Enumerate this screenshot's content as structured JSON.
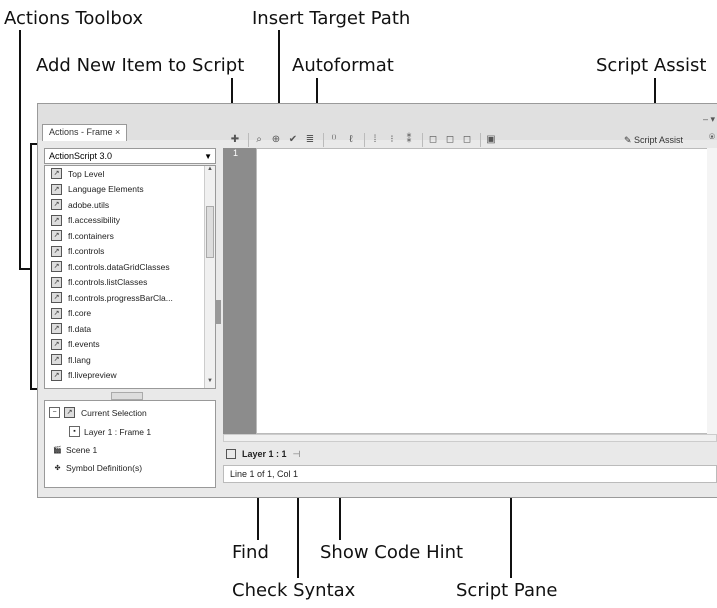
{
  "callouts": {
    "actions_toolbox": "Actions Toolbox",
    "insert_target_path": "Insert Target Path",
    "add_new_item": "Add New Item to Script",
    "autoformat": "Autoformat",
    "script_assist": "Script Assist",
    "find": "Find",
    "show_code_hint": "Show Code Hint",
    "check_syntax": "Check Syntax",
    "script_pane": "Script Pane"
  },
  "panel": {
    "tab_label": "Actions - Frame ×",
    "actionscript_version": "ActionScript 3.0",
    "toolbox_items": [
      "Top Level",
      "Language Elements",
      "adobe.utils",
      "fl.accessibility",
      "fl.containers",
      "fl.controls",
      "fl.controls.dataGridClasses",
      "fl.controls.listClasses",
      "fl.controls.progressBarCla...",
      "fl.core",
      "fl.data",
      "fl.events",
      "fl.lang",
      "fl.livepreview"
    ],
    "lower_items": {
      "current_selection": "Current Selection",
      "layer_frame": "Layer 1 : Frame 1",
      "scene": "Scene 1",
      "symbol_definitions": "Symbol Definition(s)"
    },
    "line_number": "1",
    "script_assist_label": "Script Assist",
    "layer_tab": "Layer 1 : 1",
    "status": "Line 1 of 1, Col 1"
  }
}
